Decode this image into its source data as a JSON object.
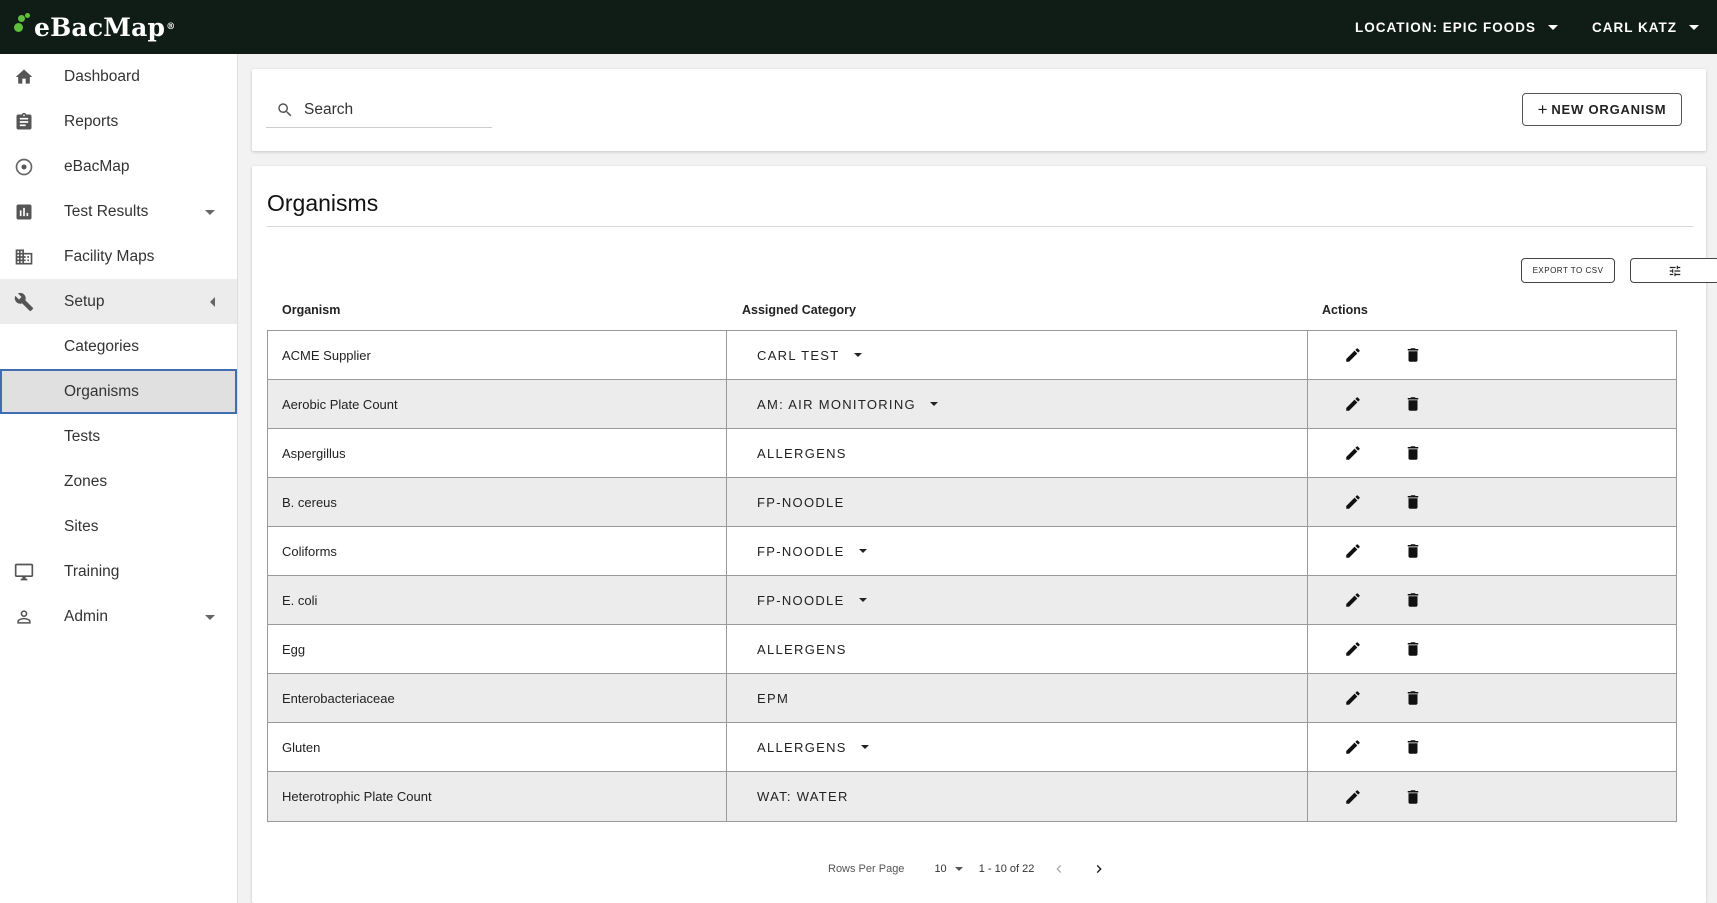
{
  "app": {
    "logo_text": "eBacMap",
    "logo_mark": "®",
    "location_label": "LOCATION: EPIC FOODS",
    "user_label": "CARL KATZ"
  },
  "sidebar": {
    "items": [
      {
        "label": "Dashboard",
        "icon": "home-icon"
      },
      {
        "label": "Reports",
        "icon": "clipboard-icon"
      },
      {
        "label": "eBacMap",
        "icon": "target-icon"
      },
      {
        "label": "Test Results",
        "icon": "bar-chart-icon"
      },
      {
        "label": "Facility Maps",
        "icon": "building-icon"
      },
      {
        "label": "Setup",
        "icon": "wrench-icon"
      },
      {
        "label": "Categories"
      },
      {
        "label": "Organisms"
      },
      {
        "label": "Tests"
      },
      {
        "label": "Zones"
      },
      {
        "label": "Sites"
      },
      {
        "label": "Training",
        "icon": "monitor-icon"
      },
      {
        "label": "Admin",
        "icon": "person-icon"
      }
    ]
  },
  "search": {
    "placeholder": "Search",
    "new_button": "NEW ORGANISM",
    "new_button_icon": "+"
  },
  "main": {
    "title": "Organisms",
    "export_button": "EXPORT TO CSV",
    "columns": [
      "Organism",
      "Assigned Category",
      "Actions"
    ],
    "rows": [
      {
        "organism": "ACME Supplier",
        "category": "CARL TEST",
        "has_dropdown": true
      },
      {
        "organism": "Aerobic Plate Count",
        "category": "AM: AIR MONITORING",
        "has_dropdown": true
      },
      {
        "organism": "Aspergillus",
        "category": "ALLERGENS",
        "has_dropdown": false
      },
      {
        "organism": "B. cereus",
        "category": "FP-NOODLE",
        "has_dropdown": false
      },
      {
        "organism": "Coliforms",
        "category": "FP-NOODLE",
        "has_dropdown": true
      },
      {
        "organism": "E. coli",
        "category": "FP-NOODLE",
        "has_dropdown": true
      },
      {
        "organism": "Egg",
        "category": "ALLERGENS",
        "has_dropdown": false
      },
      {
        "organism": "Enterobacteriaceae",
        "category": "EPM",
        "has_dropdown": false
      },
      {
        "organism": "Gluten",
        "category": "ALLERGENS",
        "has_dropdown": true
      },
      {
        "organism": "Heterotrophic Plate Count",
        "category": "WAT: WATER",
        "has_dropdown": false
      }
    ]
  },
  "pagination": {
    "rows_per_page_label": "Rows Per Page",
    "rows_per_page": "10",
    "range": "1 - 10 of 22"
  },
  "colors": {
    "topbar": "#0f1d16",
    "logo_dots": "#5fbf3a",
    "active_border": "#3f6fb0"
  }
}
